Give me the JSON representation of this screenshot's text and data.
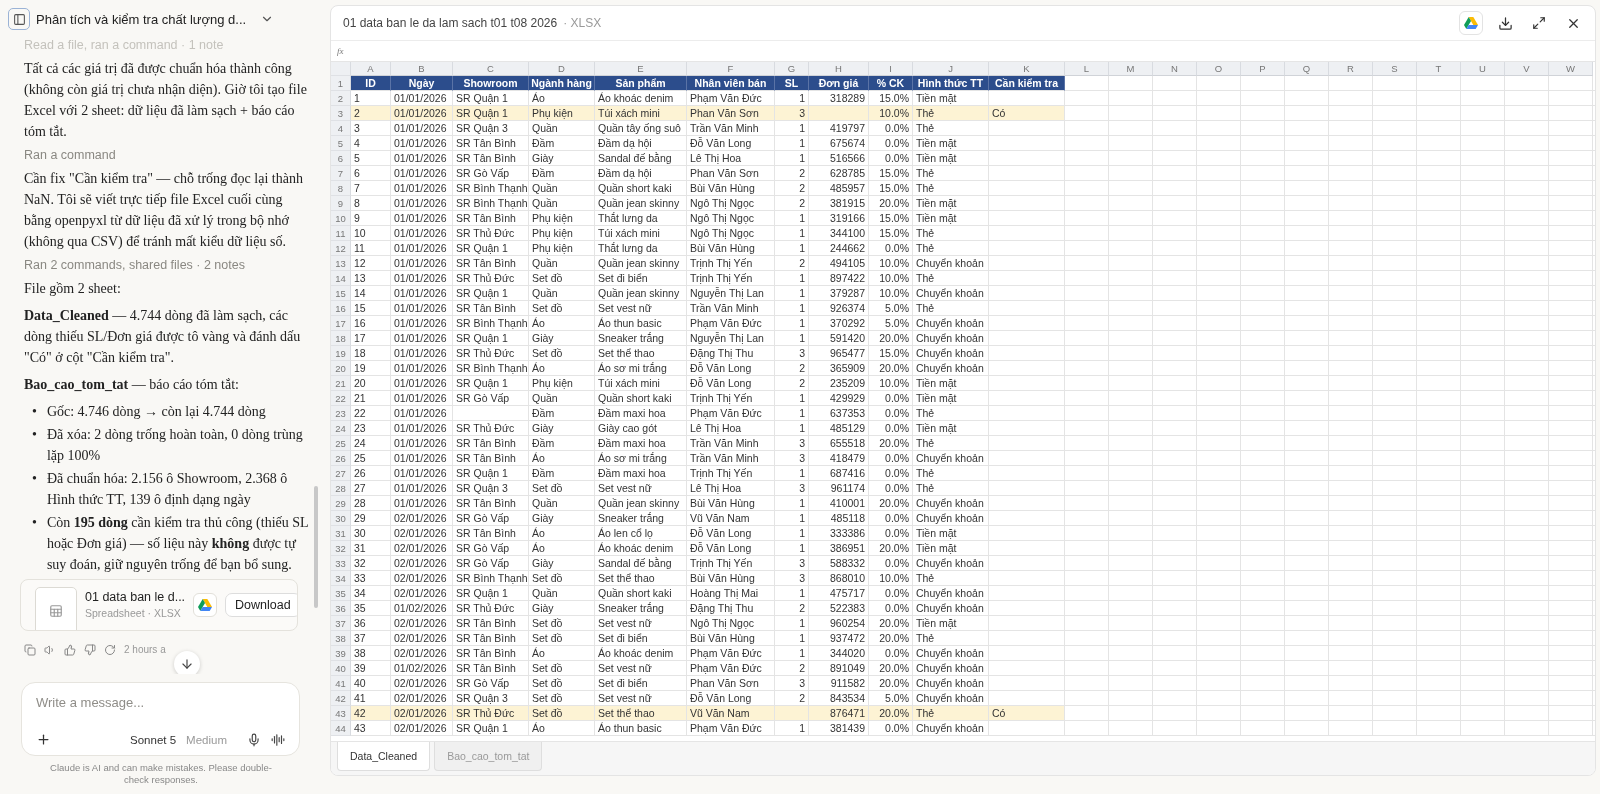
{
  "chat": {
    "title": "Phân tích và kiểm tra chất lượng d...",
    "blocks": [
      {
        "kind": "step",
        "text": "Read a file, ran a command · 1 note",
        "faded": true
      },
      {
        "kind": "paragraph",
        "text": "Tất cả các giá trị đã được chuẩn hóa thành công (không còn giá trị chưa nhận diện). Giờ tôi tạo file Excel với 2 sheet: dữ liệu đã làm sạch + báo cáo tóm tắt."
      },
      {
        "kind": "step",
        "text": "Ran a command",
        "faded": false
      },
      {
        "kind": "paragraph",
        "text": "Cần fix \"Cần kiểm tra\" — chỗ trống đọc lại thành NaN. Tôi sẽ viết trực tiếp file Excel cuối cùng bằng openpyxl từ dữ liệu đã xử lý trong bộ nhớ (không qua CSV) để tránh mất kiểu dữ liệu số."
      },
      {
        "kind": "step",
        "text": "Ran 2 commands, shared files · 2 notes",
        "faded": false
      },
      {
        "kind": "paragraph",
        "text": "File gồm 2 sheet:"
      },
      {
        "kind": "paragraph",
        "text": "**Data_Cleaned** — 4.744 dòng đã làm sạch, các dòng thiếu SL/Đơn giá được tô vàng và đánh dấu \"Có\" ở cột \"Cần kiểm tra\"."
      },
      {
        "kind": "paragraph",
        "text": "**Bao_cao_tom_tat** — báo cáo tóm tắt:"
      },
      {
        "kind": "bullets",
        "marker": "•",
        "items": [
          "Gốc: 4.746 dòng → còn lại 4.744 dòng",
          "Đã xóa: 2 dòng trống hoàn toàn, 0 dòng trùng lặp 100%",
          "Đã chuẩn hóa: 2.156 ô Showroom, 2.368 ô Hình thức TT, 139 ô định dạng ngày",
          "Còn **195 dòng** cần kiểm tra thủ công (thiếu SL hoặc Đơn giá) — số liệu này **không** được tự suy đoán, giữ nguyên trống để bạn bổ sung."
        ]
      }
    ],
    "attachment": {
      "name": "01 data ban le d...",
      "meta": "Spreadsheet · XLSX",
      "button": "Download"
    },
    "time": "2 hours a",
    "composer": {
      "placeholder": "Write a message...",
      "model": "Sonnet 5",
      "effort": "Medium"
    },
    "disclaimer": "Claude is AI and can make mistakes. Please double-check responses."
  },
  "viewer": {
    "file_name": "01 data ban le da lam sach t01 t08 2026",
    "file_type": "· XLSX",
    "formula_label": "fx",
    "column_letters": [
      "A",
      "B",
      "C",
      "D",
      "E",
      "F",
      "G",
      "H",
      "I",
      "J",
      "K",
      "L",
      "M",
      "N",
      "O",
      "P",
      "Q",
      "R",
      "S",
      "T",
      "U",
      "V",
      "W"
    ],
    "columns": [
      {
        "header": "ID",
        "numeric": false
      },
      {
        "header": "Ngày",
        "numeric": false
      },
      {
        "header": "Showroom",
        "numeric": false
      },
      {
        "header": "Ngành hàng",
        "numeric": false
      },
      {
        "header": "Sản phẩm",
        "numeric": false
      },
      {
        "header": "Nhân viên bán",
        "numeric": false
      },
      {
        "header": "SL",
        "numeric": true
      },
      {
        "header": "Đơn giá",
        "numeric": true
      },
      {
        "header": "% CK",
        "numeric": true
      },
      {
        "header": "Hình thức TT",
        "numeric": false
      },
      {
        "header": "Cần kiểm tra",
        "numeric": false
      }
    ],
    "header_row_number": "1",
    "rows": [
      {
        "row_number": "2",
        "highlighted": false,
        "cells": [
          "1",
          "01/01/2026",
          "SR Quận 1",
          "Áo",
          "Áo khoác denim",
          "Phạm Văn Đức",
          "1",
          "318289",
          "15.0%",
          "Tiền mặt",
          null
        ]
      },
      {
        "row_number": "3",
        "highlighted": true,
        "cells": [
          "2",
          "01/01/2026",
          "SR Quận 1",
          "Phụ kiện",
          "Túi xách mini",
          "Phan Văn Sơn",
          "3",
          null,
          "10.0%",
          "Thẻ",
          "Có"
        ]
      },
      {
        "row_number": "4",
        "highlighted": false,
        "cells": [
          "3",
          "01/01/2026",
          "SR Quận 3",
          "Quần",
          "Quần tây ống suô",
          "Trần Văn Minh",
          "1",
          "419797",
          "0.0%",
          "Thẻ",
          null
        ]
      },
      {
        "row_number": "5",
        "highlighted": false,
        "cells": [
          "4",
          "01/01/2026",
          "SR Tân Bình",
          "Đầm",
          "Đầm dạ hội",
          "Đỗ Văn Long",
          "1",
          "675674",
          "0.0%",
          "Tiền mặt",
          null
        ]
      },
      {
        "row_number": "6",
        "highlighted": false,
        "cells": [
          "5",
          "01/01/2026",
          "SR Tân Bình",
          "Giày",
          "Sandal đế bằng",
          "Lê Thị Hoa",
          "1",
          "516566",
          "0.0%",
          "Tiền mặt",
          null
        ]
      },
      {
        "row_number": "7",
        "highlighted": false,
        "cells": [
          "6",
          "01/01/2026",
          "SR Gò Vấp",
          "Đầm",
          "Đầm dạ hội",
          "Phan Văn Sơn",
          "2",
          "628785",
          "15.0%",
          "Thẻ",
          null
        ]
      },
      {
        "row_number": "8",
        "highlighted": false,
        "cells": [
          "7",
          "01/01/2026",
          "SR Bình Thạnh",
          "Quần",
          "Quần short kaki",
          "Bùi Văn Hùng",
          "2",
          "485957",
          "15.0%",
          "Thẻ",
          null
        ]
      },
      {
        "row_number": "9",
        "highlighted": false,
        "cells": [
          "8",
          "01/01/2026",
          "SR Bình Thạnh",
          "Quần",
          "Quần jean skinny",
          "Ngô Thị Ngọc",
          "2",
          "381915",
          "20.0%",
          "Tiền mặt",
          null
        ]
      },
      {
        "row_number": "10",
        "highlighted": false,
        "cells": [
          "9",
          "01/01/2026",
          "SR Tân Bình",
          "Phụ kiện",
          "Thắt lưng da",
          "Ngô Thị Ngọc",
          "1",
          "319166",
          "15.0%",
          "Tiền mặt",
          null
        ]
      },
      {
        "row_number": "11",
        "highlighted": false,
        "cells": [
          "10",
          "01/01/2026",
          "SR Thủ Đức",
          "Phụ kiện",
          "Túi xách mini",
          "Ngô Thị Ngọc",
          "1",
          "344100",
          "15.0%",
          "Thẻ",
          null
        ]
      },
      {
        "row_number": "12",
        "highlighted": false,
        "cells": [
          "11",
          "01/01/2026",
          "SR Quận 1",
          "Phụ kiện",
          "Thắt lưng da",
          "Bùi Văn Hùng",
          "1",
          "244662",
          "0.0%",
          "Thẻ",
          null
        ]
      },
      {
        "row_number": "13",
        "highlighted": false,
        "cells": [
          "12",
          "01/01/2026",
          "SR Tân Bình",
          "Quần",
          "Quần jean skinny",
          "Trịnh Thị Yến",
          "2",
          "494105",
          "10.0%",
          "Chuyển khoản",
          null
        ]
      },
      {
        "row_number": "14",
        "highlighted": false,
        "cells": [
          "13",
          "01/01/2026",
          "SR Thủ Đức",
          "Set đồ",
          "Set đi biển",
          "Trịnh Thị Yến",
          "1",
          "897422",
          "10.0%",
          "Thẻ",
          null
        ]
      },
      {
        "row_number": "15",
        "highlighted": false,
        "cells": [
          "14",
          "01/01/2026",
          "SR Quận 1",
          "Quần",
          "Quần jean skinny",
          "Nguyễn Thị Lan",
          "1",
          "379287",
          "10.0%",
          "Chuyển khoản",
          null
        ]
      },
      {
        "row_number": "16",
        "highlighted": false,
        "cells": [
          "15",
          "01/01/2026",
          "SR Tân Bình",
          "Set đồ",
          "Set vest nữ",
          "Trần Văn Minh",
          "1",
          "926374",
          "5.0%",
          "Thẻ",
          null
        ]
      },
      {
        "row_number": "17",
        "highlighted": false,
        "cells": [
          "16",
          "01/01/2026",
          "SR Bình Thạnh",
          "Áo",
          "Áo thun basic",
          "Phạm Văn Đức",
          "1",
          "370292",
          "5.0%",
          "Chuyển khoản",
          null
        ]
      },
      {
        "row_number": "18",
        "highlighted": false,
        "cells": [
          "17",
          "01/01/2026",
          "SR Quận 1",
          "Giày",
          "Sneaker trắng",
          "Nguyễn Thị Lan",
          "1",
          "591420",
          "20.0%",
          "Chuyển khoản",
          null
        ]
      },
      {
        "row_number": "19",
        "highlighted": false,
        "cells": [
          "18",
          "01/01/2026",
          "SR Thủ Đức",
          "Set đồ",
          "Set thể thao",
          "Đặng Thị Thu",
          "3",
          "965477",
          "15.0%",
          "Chuyển khoản",
          null
        ]
      },
      {
        "row_number": "20",
        "highlighted": false,
        "cells": [
          "19",
          "01/01/2026",
          "SR Bình Thạnh",
          "Áo",
          "Áo sơ mi trắng",
          "Đỗ Văn Long",
          "2",
          "365909",
          "20.0%",
          "Chuyển khoản",
          null
        ]
      },
      {
        "row_number": "21",
        "highlighted": false,
        "cells": [
          "20",
          "01/01/2026",
          "SR Quận 1",
          "Phụ kiện",
          "Túi xách mini",
          "Đỗ Văn Long",
          "2",
          "235209",
          "10.0%",
          "Tiền mặt",
          null
        ]
      },
      {
        "row_number": "22",
        "highlighted": false,
        "cells": [
          "21",
          "01/01/2026",
          "SR Gò Vấp",
          "Quần",
          "Quần short kaki",
          "Trịnh Thị Yến",
          "1",
          "429929",
          "0.0%",
          "Tiền mặt",
          null
        ]
      },
      {
        "row_number": "23",
        "highlighted": false,
        "cells": [
          "22",
          "01/01/2026",
          null,
          "Đầm",
          "Đầm maxi hoa",
          "Phạm Văn Đức",
          "1",
          "637353",
          "0.0%",
          "Thẻ",
          null
        ]
      },
      {
        "row_number": "24",
        "highlighted": false,
        "cells": [
          "23",
          "01/01/2026",
          "SR Thủ Đức",
          "Giày",
          "Giày cao gót",
          "Lê Thị Hoa",
          "1",
          "485129",
          "0.0%",
          "Tiền mặt",
          null
        ]
      },
      {
        "row_number": "25",
        "highlighted": false,
        "cells": [
          "24",
          "01/01/2026",
          "SR Tân Bình",
          "Đầm",
          "Đầm maxi hoa",
          "Trần Văn Minh",
          "3",
          "655518",
          "20.0%",
          "Thẻ",
          null
        ]
      },
      {
        "row_number": "26",
        "highlighted": false,
        "cells": [
          "25",
          "01/01/2026",
          "SR Tân Bình",
          "Áo",
          "Áo sơ mi trắng",
          "Trần Văn Minh",
          "3",
          "418479",
          "0.0%",
          "Chuyển khoản",
          null
        ]
      },
      {
        "row_number": "27",
        "highlighted": false,
        "cells": [
          "26",
          "01/01/2026",
          "SR Quận 1",
          "Đầm",
          "Đầm maxi hoa",
          "Trịnh Thị Yến",
          "1",
          "687416",
          "0.0%",
          "Thẻ",
          null
        ]
      },
      {
        "row_number": "28",
        "highlighted": false,
        "cells": [
          "27",
          "01/01/2026",
          "SR Quận 3",
          "Set đồ",
          "Set vest nữ",
          "Lê Thị Hoa",
          "3",
          "961174",
          "0.0%",
          "Thẻ",
          null
        ]
      },
      {
        "row_number": "29",
        "highlighted": false,
        "cells": [
          "28",
          "01/01/2026",
          "SR Tân Bình",
          "Quần",
          "Quần jean skinny",
          "Bùi Văn Hùng",
          "1",
          "410001",
          "20.0%",
          "Chuyển khoản",
          null
        ]
      },
      {
        "row_number": "30",
        "highlighted": false,
        "cells": [
          "29",
          "02/01/2026",
          "SR Gò Vấp",
          "Giày",
          "Sneaker trắng",
          "Vũ Văn Nam",
          "1",
          "485118",
          "0.0%",
          "Chuyển khoản",
          null
        ]
      },
      {
        "row_number": "31",
        "highlighted": false,
        "cells": [
          "30",
          "02/01/2026",
          "SR Tân Bình",
          "Áo",
          "Áo len cổ lọ",
          "Đỗ Văn Long",
          "1",
          "333386",
          "0.0%",
          "Tiền mặt",
          null
        ]
      },
      {
        "row_number": "32",
        "highlighted": false,
        "cells": [
          "31",
          "02/01/2026",
          "SR Gò Vấp",
          "Áo",
          "Áo khoác denim",
          "Đỗ Văn Long",
          "1",
          "386951",
          "20.0%",
          "Tiền mặt",
          null
        ]
      },
      {
        "row_number": "33",
        "highlighted": false,
        "cells": [
          "32",
          "02/01/2026",
          "SR Gò Vấp",
          "Giày",
          "Sandal đế bằng",
          "Trịnh Thị Yến",
          "3",
          "588332",
          "0.0%",
          "Chuyển khoản",
          null
        ]
      },
      {
        "row_number": "34",
        "highlighted": false,
        "cells": [
          "33",
          "02/01/2026",
          "SR Bình Thạnh",
          "Set đồ",
          "Set thể thao",
          "Bùi Văn Hùng",
          "3",
          "868010",
          "10.0%",
          "Thẻ",
          null
        ]
      },
      {
        "row_number": "35",
        "highlighted": false,
        "cells": [
          "34",
          "02/01/2026",
          "SR Quận 1",
          "Quần",
          "Quần short kaki",
          "Hoàng Thị Mai",
          "1",
          "475717",
          "0.0%",
          "Chuyển khoản",
          null
        ]
      },
      {
        "row_number": "36",
        "highlighted": false,
        "cells": [
          "35",
          "01/02/2026",
          "SR Thủ Đức",
          "Giày",
          "Sneaker trắng",
          "Đặng Thị Thu",
          "2",
          "522383",
          "0.0%",
          "Chuyển khoản",
          null
        ]
      },
      {
        "row_number": "37",
        "highlighted": false,
        "cells": [
          "36",
          "02/01/2026",
          "SR Tân Bình",
          "Set đồ",
          "Set vest nữ",
          "Ngô Thị Ngọc",
          "1",
          "960254",
          "20.0%",
          "Tiền mặt",
          null
        ]
      },
      {
        "row_number": "38",
        "highlighted": false,
        "cells": [
          "37",
          "02/01/2026",
          "SR Tân Bình",
          "Set đồ",
          "Set đi biển",
          "Bùi Văn Hùng",
          "1",
          "937472",
          "20.0%",
          "Thẻ",
          null
        ]
      },
      {
        "row_number": "39",
        "highlighted": false,
        "cells": [
          "38",
          "02/01/2026",
          "SR Tân Bình",
          "Áo",
          "Áo khoác denim",
          "Phạm Văn Đức",
          "1",
          "344020",
          "0.0%",
          "Chuyển khoản",
          null
        ]
      },
      {
        "row_number": "40",
        "highlighted": false,
        "cells": [
          "39",
          "01/02/2026",
          "SR Tân Bình",
          "Set đồ",
          "Set vest nữ",
          "Phạm Văn Đức",
          "2",
          "891049",
          "20.0%",
          "Chuyển khoản",
          null
        ]
      },
      {
        "row_number": "41",
        "highlighted": false,
        "cells": [
          "40",
          "02/01/2026",
          "SR Gò Vấp",
          "Set đồ",
          "Set đi biển",
          "Phan Văn Sơn",
          "3",
          "911582",
          "20.0%",
          "Chuyển khoản",
          null
        ]
      },
      {
        "row_number": "42",
        "highlighted": false,
        "cells": [
          "41",
          "02/01/2026",
          "SR Quận 3",
          "Set đồ",
          "Set vest nữ",
          "Đỗ Văn Long",
          "2",
          "843534",
          "5.0%",
          "Chuyển khoản",
          null
        ]
      },
      {
        "row_number": "43",
        "highlighted": true,
        "cells": [
          "42",
          "02/01/2026",
          "SR Thủ Đức",
          "Set đồ",
          "Set thể thao",
          "Vũ Văn Nam",
          null,
          "876471",
          "20.0%",
          "Thẻ",
          "Có"
        ]
      },
      {
        "row_number": "44",
        "highlighted": false,
        "cells": [
          "43",
          "02/01/2026",
          "SR Quận 1",
          "Áo",
          "Áo thun basic",
          "Phạm Văn Đức",
          "1",
          "381439",
          "0.0%",
          "Chuyển khoản",
          null
        ]
      }
    ],
    "sheet_tabs": [
      {
        "label": "Data_Cleaned",
        "selected": true
      },
      {
        "label": "Bao_cao_tom_tat",
        "selected": false
      }
    ]
  }
}
